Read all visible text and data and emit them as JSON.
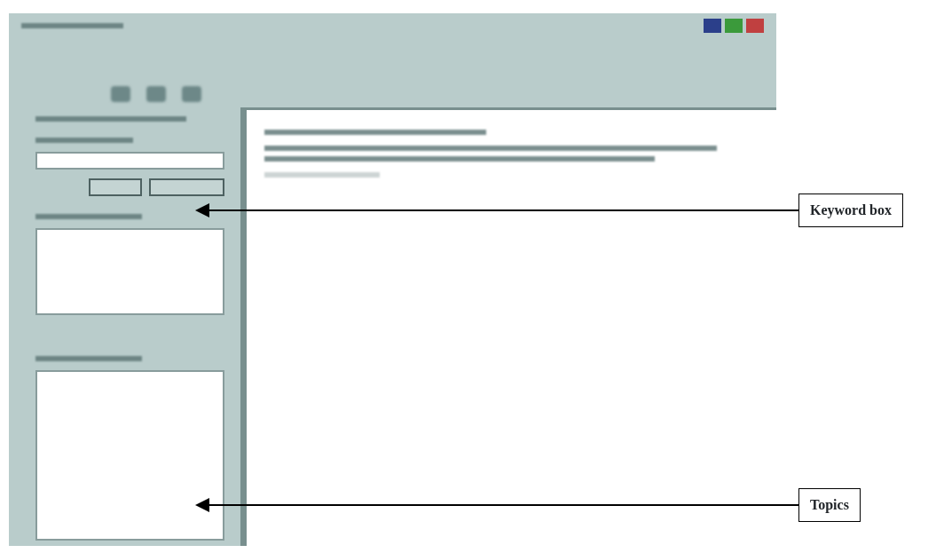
{
  "callouts": [
    {
      "label": "Keyword box",
      "kind": "upper"
    },
    {
      "label": "Topics",
      "kind": "lower"
    }
  ]
}
